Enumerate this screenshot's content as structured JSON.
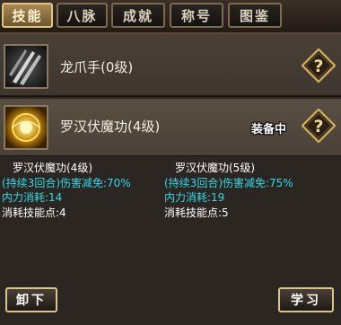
{
  "tabs": [
    {
      "label": "技能",
      "active": true
    },
    {
      "label": "八脉",
      "active": false
    },
    {
      "label": "成就",
      "active": false
    },
    {
      "label": "称号",
      "active": false
    },
    {
      "label": "图鉴",
      "active": false
    }
  ],
  "skills": [
    {
      "name": "龙爪手(0级)",
      "icon": "claw-slash-icon"
    },
    {
      "name": "罗汉伏魔功(4级)",
      "icon": "golden-orb-icon",
      "status": "装备中"
    }
  ],
  "details": {
    "current": {
      "title": "罗汉伏魔功(4级)",
      "effect": "(持续3回合)伤害减免:70%",
      "mp_cost": "内力消耗:14",
      "point_cost": "消耗技能点:4"
    },
    "next": {
      "title": "罗汉伏魔功(5级)",
      "effect": "(持续3回合)伤害减免:75%",
      "mp_cost": "内力消耗:19",
      "point_cost": "消耗技能点:5"
    }
  },
  "buttons": {
    "unequip": "卸下",
    "learn": "学习"
  },
  "colors": {
    "accent_cyan": "#34d8e8",
    "gold_border": "#d8c690"
  }
}
